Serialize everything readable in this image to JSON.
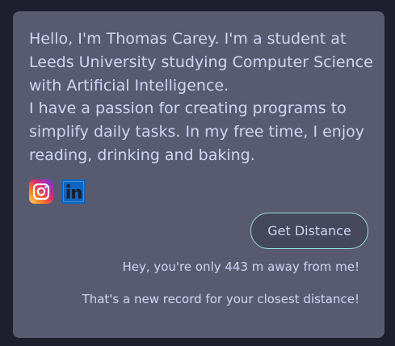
{
  "bio": {
    "line1": "Hello, I'm Thomas Carey. I'm a student at Leeds University studying Computer Science with Artificial Intelligence.",
    "line2": "I have a passion for creating programs to simplify daily tasks. In my free time, I enjoy reading, drinking and baking."
  },
  "socials": [
    {
      "icon": "instagram-icon",
      "color": "#e1306c"
    },
    {
      "icon": "linkedin-icon",
      "color": "#0a66c2"
    }
  ],
  "distance": {
    "button_label": "Get Distance",
    "result": "Hey, you're only 443 m away from me!",
    "record": "That's a new record for your closest distance!"
  },
  "colors": {
    "page_background": "#1e1e2e",
    "card_background": "#585b70",
    "text": "#cdd6f4",
    "button_border": "#94e2d5"
  }
}
